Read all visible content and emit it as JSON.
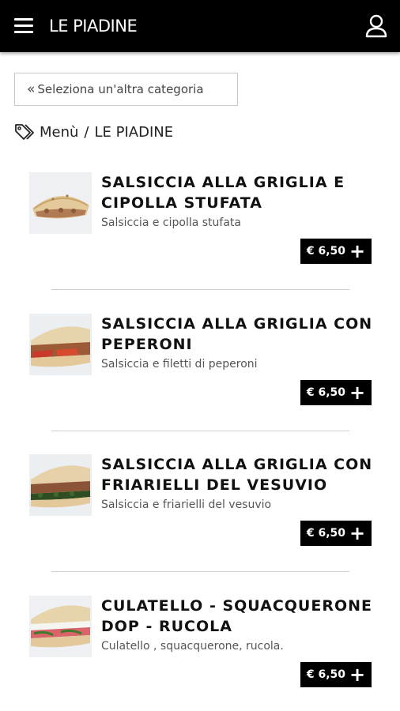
{
  "header": {
    "title": "LE PIADINE",
    "menu_icon": "hamburger-menu-icon",
    "user_icon": "user-icon"
  },
  "back_button": {
    "chevron": "«",
    "label": "Seleziona un'altra categoria"
  },
  "breadcrumb": {
    "icon": "tag-icon",
    "items": [
      "Menù",
      "LE PIADINE"
    ],
    "separator": "/"
  },
  "products": [
    {
      "name": "SALSICCIA ALLA GRIGLIA E CIPOLLA STUFATA",
      "description": "Salsiccia e cipolla stufata",
      "price": "€ 6,50",
      "add_icon": "plus-icon"
    },
    {
      "name": "SALSICCIA ALLA GRIGLIA CON PEPERONI",
      "description": "Salsiccia e filetti di peperoni",
      "price": "€ 6,50",
      "add_icon": "plus-icon"
    },
    {
      "name": "SALSICCIA ALLA GRIGLIA CON FRIARIELLI DEL VESUVIO",
      "description": "Salsiccia e friarielli del vesuvio",
      "price": "€ 6,50",
      "add_icon": "plus-icon"
    },
    {
      "name": "CULATELLO - SQUACQUERONE DOP - RUCOLA",
      "description": "Culatello , squacquerone, rucola.",
      "price": "€ 6,50",
      "add_icon": "plus-icon"
    }
  ],
  "colors": {
    "header_bg": "#000000",
    "button_bg": "#000000",
    "text": "#111111"
  }
}
